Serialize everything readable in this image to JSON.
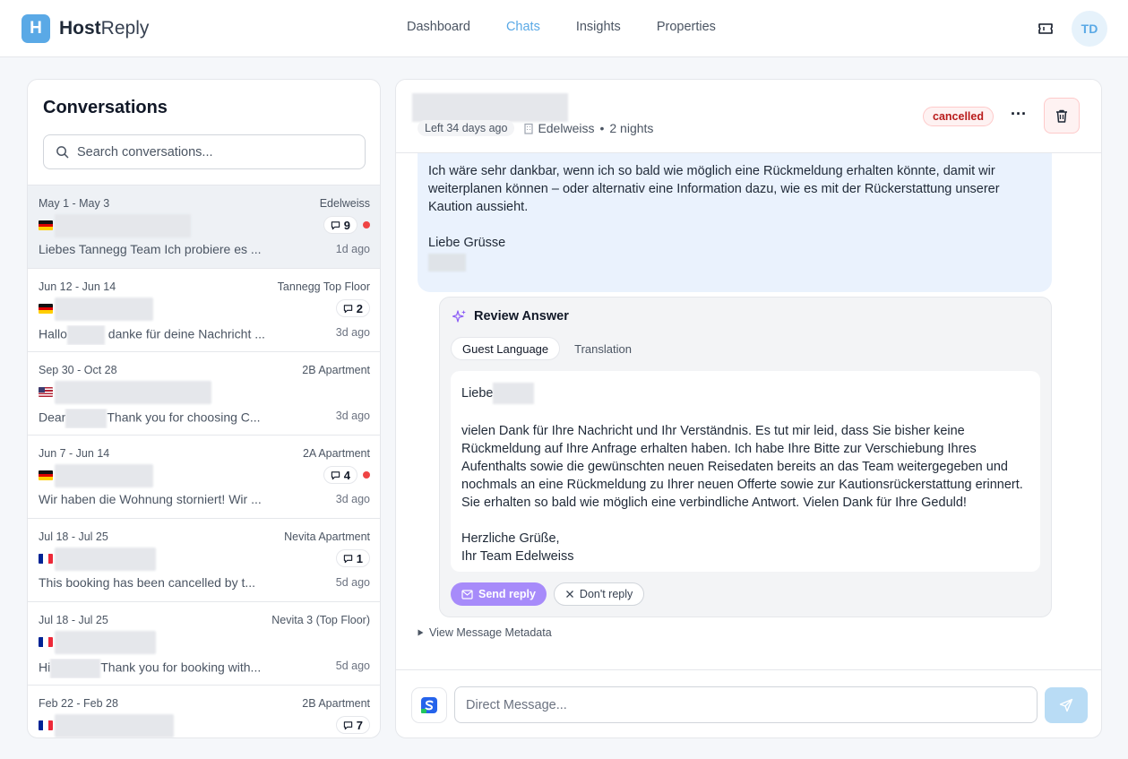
{
  "app": {
    "logo_letter": "H",
    "name_bold": "Host",
    "name_light": "Reply"
  },
  "nav": {
    "items": [
      {
        "label": "Dashboard",
        "active": false
      },
      {
        "label": "Chats",
        "active": true
      },
      {
        "label": "Insights",
        "active": false
      },
      {
        "label": "Properties",
        "active": false
      }
    ],
    "ticket_icon": "ticket-icon",
    "avatar_initials": "TD"
  },
  "conversations": {
    "title": "Conversations",
    "search_placeholder": "Search conversations...",
    "items": [
      {
        "dates": "May 1 - May 3",
        "property": "Edelweiss",
        "flag": "de",
        "count": "9",
        "unread": true,
        "preview": "Liebes Tannegg Team Ich probiere es ...",
        "time": "1d ago",
        "selected": true
      },
      {
        "dates": "Jun 12 - Jun 14",
        "property": "Tannegg Top Floor",
        "flag": "de",
        "count": "2",
        "unread": false,
        "preview_before": "Hallo",
        "preview_after": "danke für deine Nachricht ...",
        "time": "3d ago",
        "selected": false
      },
      {
        "dates": "Sep 30 - Oct 28",
        "property": "2B Apartment",
        "flag": "us",
        "count": "",
        "unread": false,
        "preview_before": "Dear",
        "preview_after": "Thank you for choosing C...",
        "time": "3d ago",
        "selected": false
      },
      {
        "dates": "Jun 7 - Jun 14",
        "property": "2A Apartment",
        "flag": "de",
        "count": "4",
        "unread": true,
        "preview": "Wir haben die Wohnung storniert! Wir ...",
        "time": "3d ago",
        "selected": false
      },
      {
        "dates": "Jul 18 - Jul 25",
        "property": "Nevita Apartment",
        "flag": "fr",
        "count": "1",
        "unread": false,
        "preview": "This booking has been cancelled by t...",
        "time": "5d ago",
        "selected": false
      },
      {
        "dates": "Jul 18 - Jul 25",
        "property": "Nevita 3 (Top Floor)",
        "flag": "fr",
        "count": "",
        "unread": false,
        "preview_before": "Hi",
        "preview_after": "Thank you for booking with...",
        "time": "5d ago",
        "selected": false
      },
      {
        "dates": "Feb 22 - Feb 28",
        "property": "2B Apartment",
        "flag": "fr",
        "count": "7",
        "unread": false,
        "preview": "",
        "time": "",
        "selected": false
      }
    ]
  },
  "chat": {
    "left_label": "Left 34 days ago",
    "property": "Edelweiss",
    "nights": "2 nights",
    "separator": "•",
    "status": "cancelled",
    "more_label": "···",
    "guest_message": {
      "para1": "Ich wäre sehr dankbar, wenn ich so bald wie möglich eine Rückmeldung erhalten könnte, damit wir weiterplanen können – oder alternativ eine Information dazu, wie es mit der Rückerstattung unserer Kaution aussieht.",
      "closing": "Liebe Grüsse"
    },
    "review": {
      "title": "Review Answer",
      "tab_guest": "Guest Language",
      "tab_translation": "Translation",
      "greeting": "Liebe",
      "body": "vielen Dank für Ihre Nachricht und Ihr Verständnis. Es tut mir leid, dass Sie bisher keine Rückmeldung auf Ihre Anfrage erhalten haben. Ich habe Ihre Bitte zur Verschiebung Ihres Aufenthalts sowie die gewünschten neuen Reisedaten bereits an das Team weitergegeben und nochmals an eine Rückmeldung zu Ihrer neuen Offerte sowie zur Kautionsrückerstattung erinnert. Sie erhalten so bald wie möglich eine verbindliche Antwort. Vielen Dank für Ihre Geduld!",
      "signoff1": "Herzliche Grüße,",
      "signoff2": "Ihr Team Edelweiss",
      "send_label": "Send reply",
      "dont_label": "Don't reply"
    },
    "metadata_label": "View Message Metadata",
    "composer_placeholder": "Direct Message..."
  }
}
